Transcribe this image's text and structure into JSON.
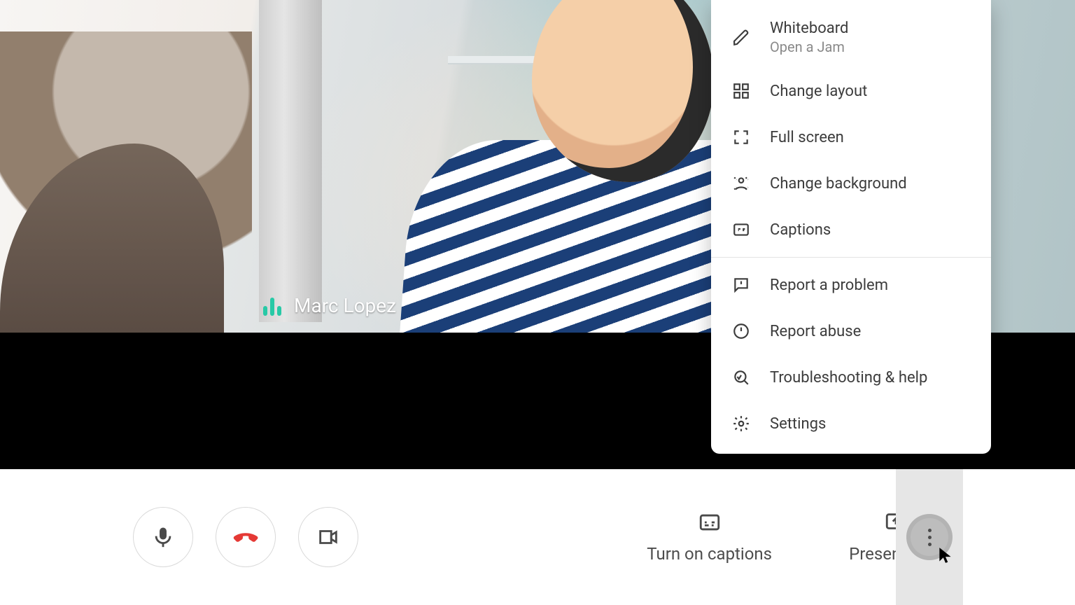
{
  "participant": {
    "name": "Marc Lopez"
  },
  "bottom": {
    "captions_label": "Turn on captions",
    "present_label": "Present now"
  },
  "menu": {
    "items": [
      {
        "label": "Whiteboard",
        "sub": "Open a Jam",
        "icon": "pencil-icon"
      },
      {
        "label": "Change layout",
        "icon": "layout-icon"
      },
      {
        "label": "Full screen",
        "icon": "fullscreen-icon"
      },
      {
        "label": "Change background",
        "icon": "background-icon"
      },
      {
        "label": "Captions",
        "icon": "captions-icon"
      }
    ],
    "items2": [
      {
        "label": "Report a problem",
        "icon": "feedback-icon"
      },
      {
        "label": "Report abuse",
        "icon": "abuse-icon"
      },
      {
        "label": "Troubleshooting & help",
        "icon": "troubleshoot-icon"
      },
      {
        "label": "Settings",
        "icon": "settings-icon"
      }
    ]
  }
}
